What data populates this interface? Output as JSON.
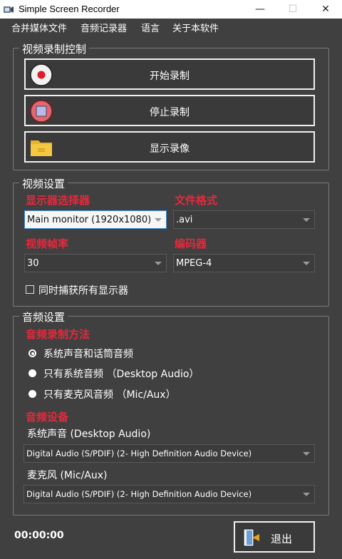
{
  "window": {
    "title": "Simple Screen Recorder",
    "minimize": "—",
    "maximize": "☐",
    "close": "✕"
  },
  "menu": [
    "合并媒体文件",
    "音频记录器",
    "语言",
    "关于本软件"
  ],
  "video_control": {
    "group_title": "视频录制控制",
    "start_label": "开始录制",
    "stop_label": "停止录制",
    "show_label": "显示录像"
  },
  "video_settings": {
    "group_title": "视频设置",
    "monitor_label": "显示器选择器",
    "monitor_value": "Main monitor (1920x1080)",
    "format_label": "文件格式",
    "format_value": ".avi",
    "fps_label": "视频帧率",
    "fps_value": "30",
    "codec_label": "编码器",
    "codec_value": "MPEG-4",
    "capture_all_label": "同时捕获所有显示器",
    "capture_all_checked": false
  },
  "audio_settings": {
    "group_title": "音频设置",
    "method_label": "音频录制方法",
    "options": [
      {
        "label": "系统声音和话筒音频",
        "checked": true
      },
      {
        "label": "只有系统音频 （Desktop Audio）",
        "checked": false
      },
      {
        "label": "只有麦克风音频 （Mic/Aux）",
        "checked": false
      }
    ],
    "device_label": "音频设备",
    "desktop_label": "系统声音 (Desktop Audio)",
    "desktop_value": "Digital Audio (S/PDIF) (2- High Definition Audio Device)",
    "mic_label": "麦克风 (Mic/Aux)",
    "mic_value": "Digital Audio (S/PDIF) (2- High Definition Audio Device)"
  },
  "footer": {
    "timer": "00:00:00",
    "exit_label": "退出"
  },
  "colors": {
    "background": "#404040",
    "accent_red": "#e8283c",
    "border": "#f0f0f0"
  }
}
